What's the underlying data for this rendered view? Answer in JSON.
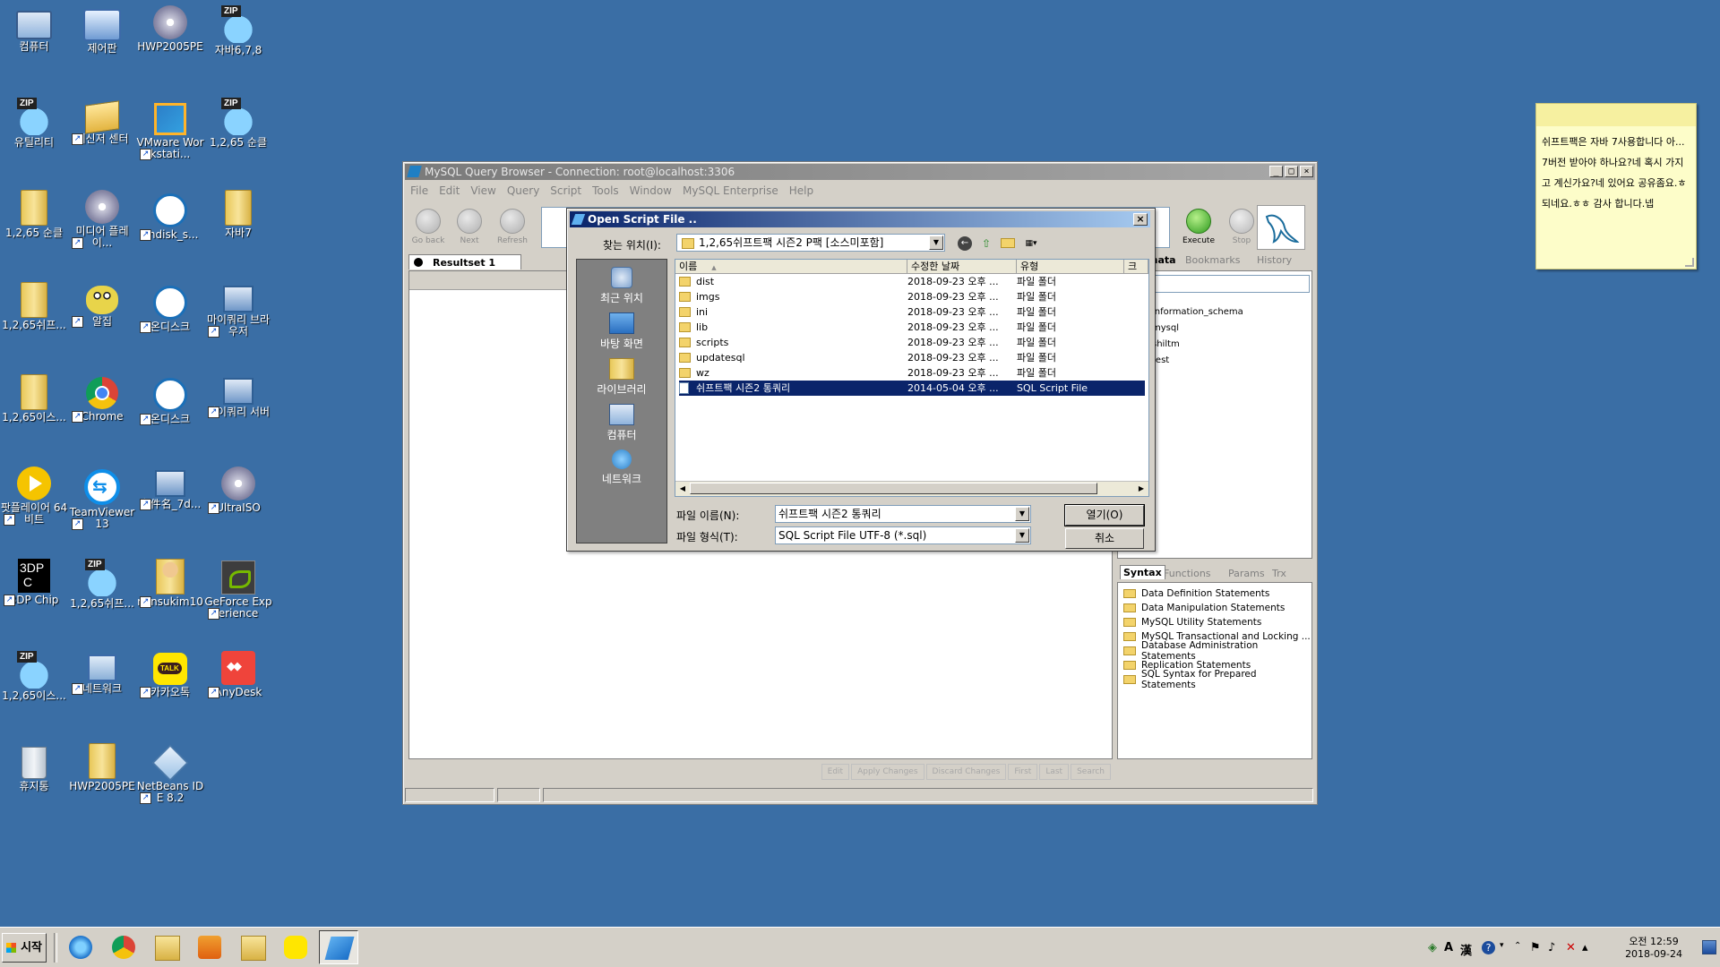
{
  "desktop": {
    "icons": [
      {
        "label": "컴퓨터",
        "icon": "computer-icon"
      },
      {
        "label": "제어판",
        "icon": "control-panel-icon"
      },
      {
        "label": "HWP2005PE",
        "icon": "installer-disc-icon"
      },
      {
        "label": "자바6,7,8",
        "icon": "zip-archive-icon"
      },
      {
        "label": "유틸리티",
        "icon": "zip-archive-icon"
      },
      {
        "label": "메신저 센터",
        "icon": "messenger-center-icon"
      },
      {
        "label": "VMware Workstati...",
        "icon": "vmware-icon"
      },
      {
        "label": "1,2,65 순클",
        "icon": "zip-archive-icon"
      },
      {
        "label": "1,2,65 순클",
        "icon": "folder-icon"
      },
      {
        "label": "미디어 플레이...",
        "icon": "media-player-icon"
      },
      {
        "label": "ondisk_s...",
        "icon": "ondisk-icon"
      },
      {
        "label": "자바7",
        "icon": "folder-icon"
      },
      {
        "label": "1,2,65쉬프...",
        "icon": "folder-icon"
      },
      {
        "label": "알집",
        "icon": "alzip-icon"
      },
      {
        "label": "온디스크",
        "icon": "ondisk-icon"
      },
      {
        "label": "마이쿼리 브라우저",
        "icon": "mysql-browser-icon"
      },
      {
        "label": "1,2,65이스...",
        "icon": "folder-icon"
      },
      {
        "label": "Chrome",
        "icon": "chrome-icon"
      },
      {
        "label": "온디스크",
        "icon": "ondisk-icon"
      },
      {
        "label": "마이쿼리 서버",
        "icon": "mysql-server-icon"
      },
      {
        "label": "팟플레이어 64 비트",
        "icon": "potplayer-icon"
      },
      {
        "label": "TeamViewer 13",
        "icon": "teamviewer-icon"
      },
      {
        "label": "文件名_7d...",
        "icon": "installer-icon"
      },
      {
        "label": "UltraISO",
        "icon": "ultraiso-icon"
      },
      {
        "label": "3DP Chip",
        "icon": "3dp-chip-icon"
      },
      {
        "label": "1,2,65쉬프...",
        "icon": "zip-archive-icon"
      },
      {
        "label": "minsukim10",
        "icon": "user-folder-icon"
      },
      {
        "label": "GeForce Experience",
        "icon": "geforce-icon"
      },
      {
        "label": "1,2,65이스...",
        "icon": "zip-archive-icon"
      },
      {
        "label": "네트워크",
        "icon": "network-icon"
      },
      {
        "label": "카카오톡",
        "icon": "kakaotalk-icon"
      },
      {
        "label": "AnyDesk",
        "icon": "anydesk-icon"
      },
      {
        "label": "휴지통",
        "icon": "recycle-bin-icon"
      },
      {
        "label": "HWP2005PE",
        "icon": "folder-icon"
      },
      {
        "label": "NetBeans IDE 8.2",
        "icon": "netbeans-icon"
      }
    ]
  },
  "sticky": {
    "text": "쉬프트팩은 자바 7사용합니다 아... 7버전 받아야 하나요?네 혹시 가지고 계신가요?네 있어요 공유좀요.ㅎ 되네요.ㅎㅎ 감사 합니다.넵"
  },
  "mysql": {
    "title": "MySQL Query Browser - Connection: root@localhost:3306",
    "menu": [
      "File",
      "Edit",
      "View",
      "Query",
      "Script",
      "Tools",
      "Window",
      "MySQL Enterprise",
      "Help"
    ],
    "nav": {
      "back": "Go back",
      "next": "Next",
      "refresh": "Refresh"
    },
    "execute": "Execute",
    "stop": "Stop",
    "resultset_tab": "Resultset 1",
    "result_actions": [
      "Edit",
      "Apply Changes",
      "Discard Changes",
      "First",
      "Last",
      "Search"
    ],
    "right_tabs": [
      "mata",
      "Bookmarks",
      "History"
    ],
    "schemata": [
      "information_schema",
      "mysql",
      "shiltm",
      "test"
    ],
    "syntax_tabs": [
      "Syntax",
      "Functions",
      "Params",
      "Trx"
    ],
    "syntax_items": [
      "Data Definition Statements",
      "Data Manipulation Statements",
      "MySQL Utility Statements",
      "MySQL Transactional and Locking ...",
      "Database Administration Statements",
      "Replication Statements",
      "SQL Syntax for Prepared Statements"
    ]
  },
  "dialog": {
    "title": "Open Script File ..",
    "lookin_label": "찾는 위치(I):",
    "lookin_value": "1,2,65쉬프트팩 시즌2 P팩 [소스미포함]",
    "places": [
      "최근 위치",
      "바탕 화면",
      "라이브러리",
      "컴퓨터",
      "네트워크"
    ],
    "columns": [
      "이름",
      "수정한 날짜",
      "유형",
      "크"
    ],
    "files": [
      {
        "name": "dist",
        "date": "2018-09-23 오후 ...",
        "type": "파일 폴더",
        "kind": "folder"
      },
      {
        "name": "imgs",
        "date": "2018-09-23 오후 ...",
        "type": "파일 폴더",
        "kind": "folder"
      },
      {
        "name": "ini",
        "date": "2018-09-23 오후 ...",
        "type": "파일 폴더",
        "kind": "folder"
      },
      {
        "name": "lib",
        "date": "2018-09-23 오후 ...",
        "type": "파일 폴더",
        "kind": "folder"
      },
      {
        "name": "scripts",
        "date": "2018-09-23 오후 ...",
        "type": "파일 폴더",
        "kind": "folder"
      },
      {
        "name": "updatesql",
        "date": "2018-09-23 오후 ...",
        "type": "파일 폴더",
        "kind": "folder"
      },
      {
        "name": "wz",
        "date": "2018-09-23 오후 ...",
        "type": "파일 폴더",
        "kind": "folder"
      },
      {
        "name": "쉬프트팩 시즌2 통쿼리",
        "date": "2014-05-04 오후 ...",
        "type": "SQL Script File",
        "kind": "sql",
        "selected": true
      }
    ],
    "filename_label": "파일 이름(N):",
    "filename_value": "쉬프트팩 시즌2 통쿼리",
    "filetype_label": "파일 형식(T):",
    "filetype_value": "SQL Script File UTF-8 (*.sql)",
    "open_button": "열기(O)",
    "cancel_button": "취소"
  },
  "taskbar": {
    "start": "시작",
    "apps": [
      "internet-explorer-icon",
      "chrome-icon",
      "file-explorer-icon",
      "media-player-icon",
      "folder-icon",
      "kakaotalk-icon",
      "mysql-query-browser-icon"
    ],
    "clock_time": "오전 12:59",
    "clock_date": "2018-09-24"
  }
}
